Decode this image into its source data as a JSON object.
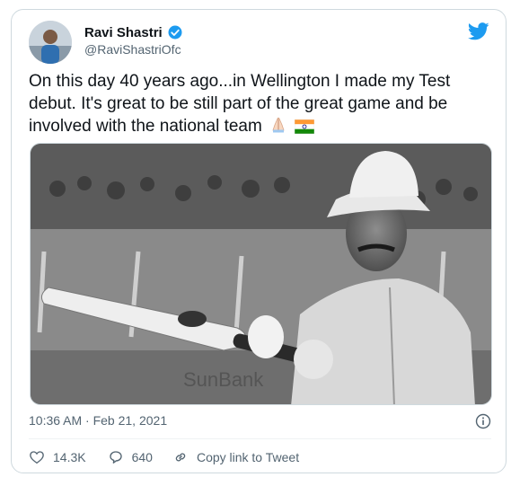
{
  "author": {
    "name": "Ravi Shastri",
    "handle": "@RaviShastriOfc"
  },
  "tweet": {
    "text": "On this day 40 years ago...in Wellington I made my Test debut. It's great to be still part of the great game and be involved with the national team",
    "emojis": [
      "folded-hands",
      "india-flag"
    ],
    "timestamp": "10:36 AM · Feb 21, 2021"
  },
  "actions": {
    "likes": "14.3K",
    "replies": "640",
    "copy_link": "Copy link to Tweet"
  },
  "colors": {
    "brand_blue": "#1d9bf0",
    "text": "#0f1419",
    "secondary": "#536471",
    "border": "#cfd9de"
  }
}
